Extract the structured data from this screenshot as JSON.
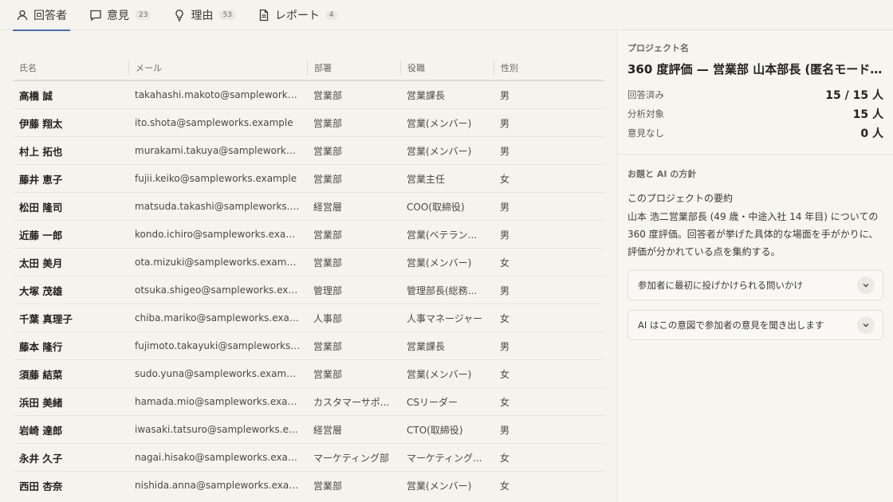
{
  "tabs": [
    {
      "label": "回答者",
      "count": ""
    },
    {
      "label": "意見",
      "count": "23"
    },
    {
      "label": "理由",
      "count": "53"
    },
    {
      "label": "レポート",
      "count": "4"
    }
  ],
  "table": {
    "headers": [
      "氏名",
      "メール",
      "部署",
      "役職",
      "性別"
    ],
    "rows": [
      [
        "高橋 誠",
        "takahashi.makoto@sampleworks.example",
        "営業部",
        "営業課長",
        "男"
      ],
      [
        "伊藤 翔太",
        "ito.shota@sampleworks.example",
        "営業部",
        "営業(メンバー)",
        "男"
      ],
      [
        "村上 拓也",
        "murakami.takuya@sampleworks.example",
        "営業部",
        "営業(メンバー)",
        "男"
      ],
      [
        "藤井 恵子",
        "fujii.keiko@sampleworks.example",
        "営業部",
        "営業主任",
        "女"
      ],
      [
        "松田 隆司",
        "matsuda.takashi@sampleworks.example",
        "経営層",
        "COO(取締役)",
        "男"
      ],
      [
        "近藤 一郎",
        "kondo.ichiro@sampleworks.example",
        "営業部",
        "営業(ベテラン...",
        "男"
      ],
      [
        "太田 美月",
        "ota.mizuki@sampleworks.example",
        "営業部",
        "営業(メンバー)",
        "女"
      ],
      [
        "大塚 茂雄",
        "otsuka.shigeo@sampleworks.example",
        "管理部",
        "管理部長(総務...",
        "男"
      ],
      [
        "千葉 真理子",
        "chiba.mariko@sampleworks.example",
        "人事部",
        "人事マネージャー",
        "女"
      ],
      [
        "藤本 隆行",
        "fujimoto.takayuki@sampleworks.example",
        "営業部",
        "営業課長",
        "男"
      ],
      [
        "須藤 結菜",
        "sudo.yuna@sampleworks.example",
        "営業部",
        "営業(メンバー)",
        "女"
      ],
      [
        "浜田 美緒",
        "hamada.mio@sampleworks.example",
        "カスタマーサポ...",
        "CSリーダー",
        "女"
      ],
      [
        "岩崎 達郎",
        "iwasaki.tatsuro@sampleworks.example",
        "経営層",
        "CTO(取締役)",
        "男"
      ],
      [
        "永井 久子",
        "nagai.hisako@sampleworks.example",
        "マーケティング部",
        "マーケティング...",
        "女"
      ],
      [
        "西田 杏奈",
        "nishida.anna@sampleworks.example",
        "営業部",
        "営業(メンバー)",
        "女"
      ]
    ]
  },
  "project": {
    "label": "プロジェクト名",
    "name": "360 度評価 — 営業部 山本部長 (匿名モード...",
    "stats": [
      {
        "key": "回答済み",
        "value": "15 / 15 人"
      },
      {
        "key": "分析対象",
        "value": "15 人"
      },
      {
        "key": "意見なし",
        "value": "0 人"
      }
    ]
  },
  "policy": {
    "label": "お題と AI の方針",
    "summary_title": "このプロジェクトの要約",
    "summary_text": "山本 浩二営業部長 (49 歳・中途入社 14 年目) についての 360 度評価。回答者が挙げた具体的な場面を手がかりに、評価が分かれている点を集約する。",
    "accordions": [
      "参加者に最初に投げかけられる問いかけ",
      "AI はこの意図で参加者の意見を聞き出します"
    ]
  },
  "icons": [
    "user-icon",
    "chat-icon",
    "bulb-icon",
    "document-icon",
    "chevron-down-icon"
  ],
  "colors": {
    "accent": "#4a6fa5",
    "background": "#f5f3ee"
  }
}
